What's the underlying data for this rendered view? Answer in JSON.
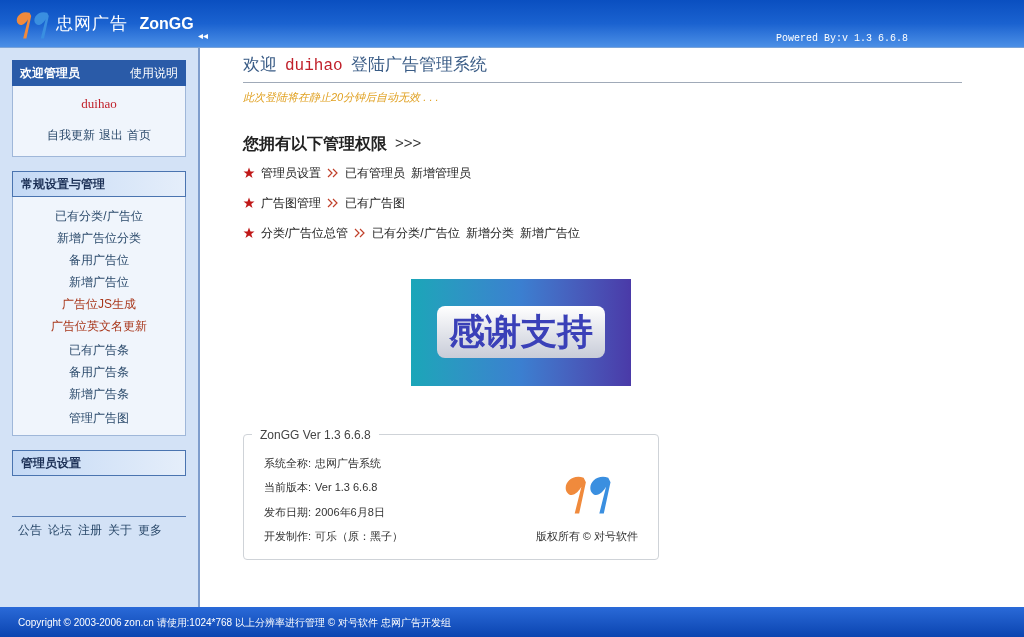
{
  "header": {
    "brand": "忠网广告",
    "brand_en": "ZonGG",
    "collapse": "◂◂",
    "powered": "Powered By:v 1.3 6.6.8"
  },
  "sidebar": {
    "welcome": {
      "title": "欢迎管理员",
      "help": "使用说明",
      "user": "duihao",
      "links": [
        "自我更新",
        "退出",
        "首页"
      ]
    },
    "sections": [
      {
        "title": "常规设置与管理",
        "groups": [
          [
            {
              "label": "已有分类/广告位",
              "kind": "normal"
            },
            {
              "label": "新增广告位分类",
              "kind": "normal"
            },
            {
              "label": "备用广告位",
              "kind": "normal"
            },
            {
              "label": "新增广告位",
              "kind": "normal"
            },
            {
              "label": "广告位JS生成",
              "kind": "tool"
            },
            {
              "label": "广告位英文名更新",
              "kind": "tool"
            }
          ],
          [
            {
              "label": "已有广告条",
              "kind": "normal"
            },
            {
              "label": "备用广告条",
              "kind": "normal"
            },
            {
              "label": "新增广告条",
              "kind": "normal"
            }
          ],
          [
            {
              "label": "管理广告图",
              "kind": "normal"
            }
          ]
        ]
      },
      {
        "title": "管理员设置"
      }
    ],
    "footer_links": [
      "公告",
      "论坛",
      "注册",
      "关于",
      "更多"
    ]
  },
  "main": {
    "welcome": {
      "prefix": "欢迎",
      "user": "duihao",
      "suffix": "登陆广告管理系统"
    },
    "notice": "此次登陆将在静止20分钟后自动无效 . . .",
    "rights_title": "您拥有以下管理权限",
    "rights_arrow": ">>>",
    "rights": [
      {
        "category": "管理员设置",
        "links": [
          "已有管理员",
          "新增管理员"
        ]
      },
      {
        "category": "广告图管理",
        "links": [
          "已有广告图"
        ]
      },
      {
        "category": "分类/广告位总管",
        "links": [
          "已有分类/广告位",
          "新增分类",
          "新增广告位"
        ]
      }
    ],
    "banner": "感谢支持",
    "info": {
      "legend": "ZonGG Ver 1.3 6.6.8",
      "rows": [
        {
          "label": "系统全称:",
          "value": "忠网广告系统"
        },
        {
          "label": "当前版本:",
          "value": "Ver 1.3 6.6.8"
        },
        {
          "label": "发布日期:",
          "value": "2006年6月8日"
        },
        {
          "label": "开发制作:",
          "value": "可乐（原：黑子）"
        }
      ],
      "copyright": "版权所有 © 对号软件"
    }
  },
  "footer": "Copyright © 2003-2006 zon.cn 请使用:1024*768 以上分辨率进行管理 © 对号软件 忠网广告开发组"
}
